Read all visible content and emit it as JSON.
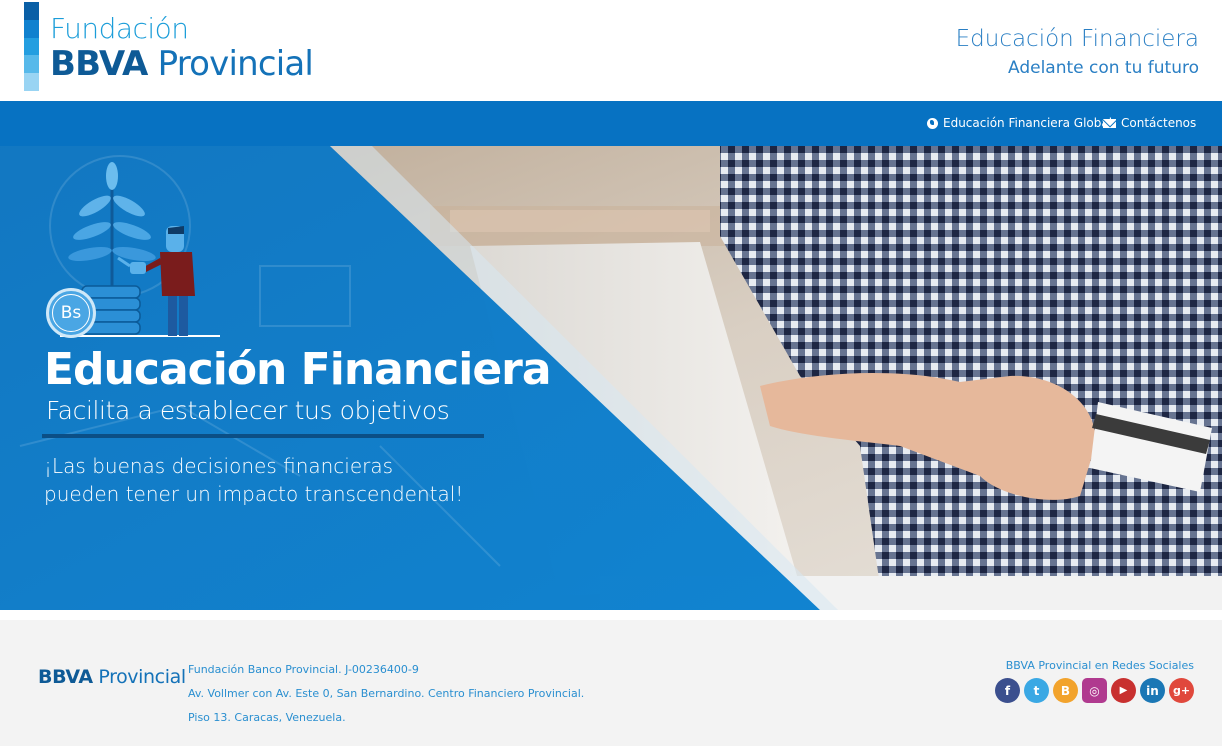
{
  "header": {
    "logo_line1": "Fundación",
    "logo_bold": "BBVA",
    "logo_rest": "Provincial",
    "title": "Educación Financiera",
    "subtitle": "Adelante con tu futuro",
    "logo_colors": [
      "#0a5fa6",
      "#1081cf",
      "#239ee0",
      "#57b9ea",
      "#99d4f3"
    ]
  },
  "nav": {
    "global_label": "Educación Financiera Global",
    "contact_label": "Contáctenos",
    "background": "#0772c2"
  },
  "hero": {
    "badge": "Bs",
    "title": "Educación Financiera",
    "subtitle": "Facilita a establecer tus objetivos",
    "message_line1": "¡Las buenas decisiones financieras",
    "message_line2": "pueden tener un impacto transcendental!",
    "accent": "#0a7ac8"
  },
  "footer": {
    "logo_bold": "BBVA",
    "logo_rest": "Provincial",
    "address_line1": "Fundación Banco Provincial. J-00236400-9",
    "address_line2": "Av. Vollmer con Av. Este 0, San Bernardino. Centro Financiero Provincial.",
    "address_line3": "Piso 13. Caracas, Venezuela.",
    "social_title": "BBVA Provincial en Redes Sociales",
    "social": [
      {
        "name": "facebook-icon",
        "glyph": "f",
        "color": "#3b4f8e"
      },
      {
        "name": "twitter-icon",
        "glyph": "t",
        "color": "#3aa8e4"
      },
      {
        "name": "blogger-icon",
        "glyph": "B",
        "color": "#f2a32c"
      },
      {
        "name": "instagram-icon",
        "glyph": "◎",
        "color": "#b03a8f"
      },
      {
        "name": "youtube-icon",
        "glyph": "▶",
        "color": "#c8302f"
      },
      {
        "name": "linkedin-icon",
        "glyph": "in",
        "color": "#1b77b5"
      },
      {
        "name": "googleplus-icon",
        "glyph": "g+",
        "color": "#e0483c"
      }
    ]
  }
}
